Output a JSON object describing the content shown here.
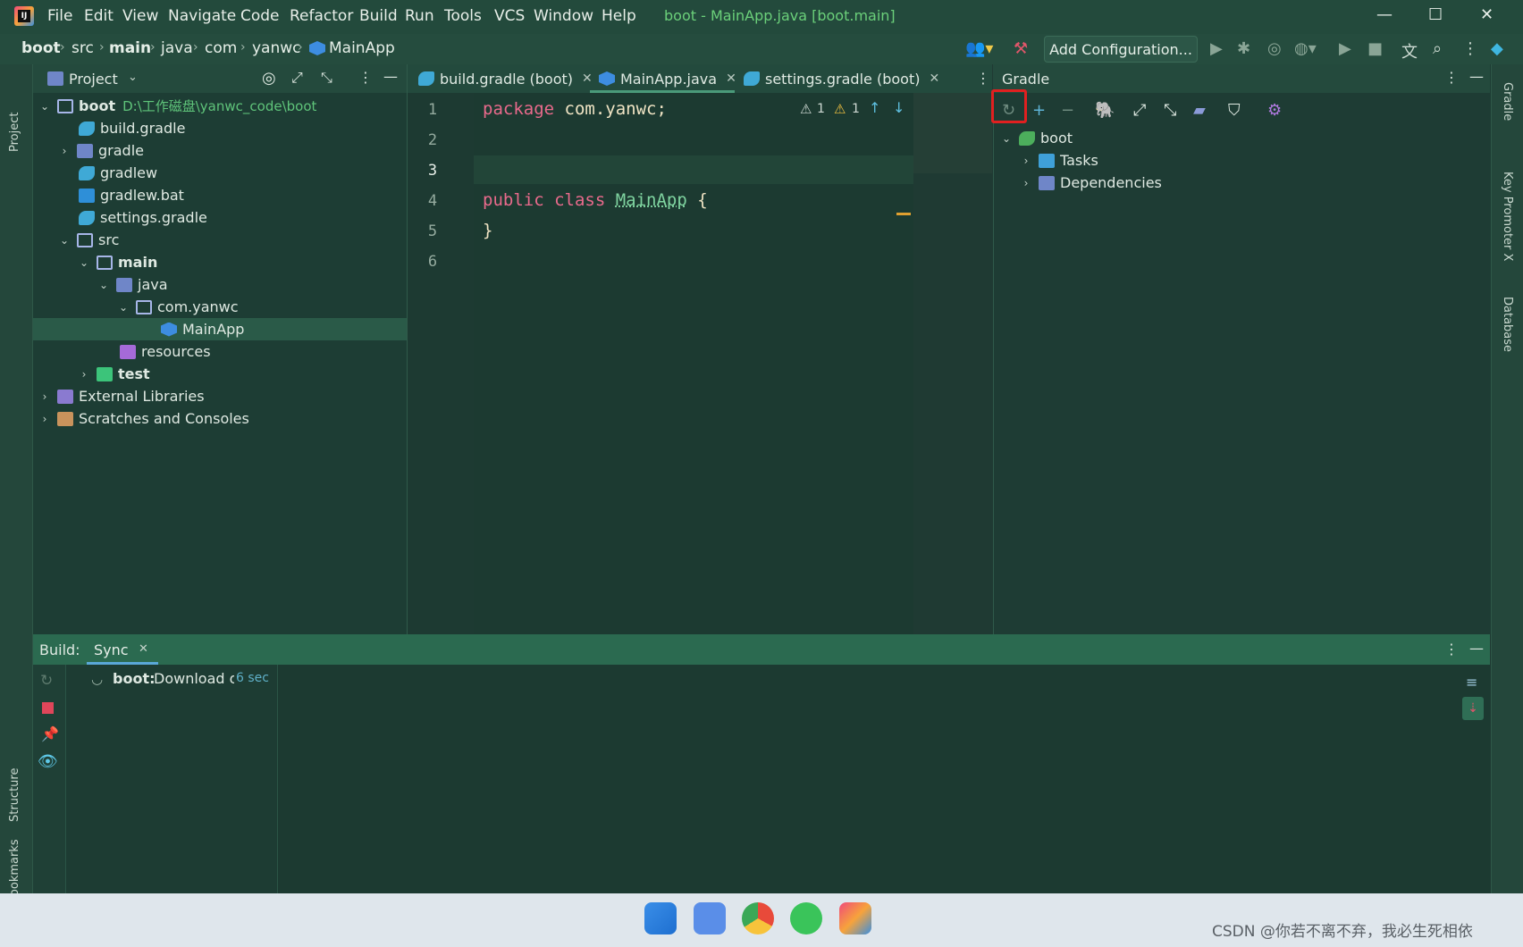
{
  "titlebar": {
    "menu": [
      "File",
      "Edit",
      "View",
      "Navigate",
      "Code",
      "Refactor",
      "Build",
      "Run",
      "Tools",
      "VCS",
      "Window",
      "Help"
    ],
    "window_title": "boot - MainApp.java [boot.main]"
  },
  "navbar": {
    "breadcrumbs": [
      "boot",
      "src",
      "main",
      "java",
      "com",
      "yanwc",
      "MainApp"
    ],
    "add_configuration": "Add Configuration..."
  },
  "left_stripe": {
    "project": "Project",
    "structure": "Structure",
    "bookmarks": "Bookmarks"
  },
  "right_stripe": {
    "gradle": "Gradle",
    "key_promoter": "Key Promoter X",
    "database": "Database"
  },
  "project_panel": {
    "title": "Project",
    "root_name": "boot",
    "root_path": "D:\\工作磁盘\\yanwc_code\\boot",
    "items": [
      {
        "label": "build.gradle"
      },
      {
        "label": "gradle"
      },
      {
        "label": "gradlew"
      },
      {
        "label": "gradlew.bat"
      },
      {
        "label": "settings.gradle"
      },
      {
        "label": "src"
      },
      {
        "label": "main"
      },
      {
        "label": "java"
      },
      {
        "label": "com.yanwc"
      },
      {
        "label": "MainApp"
      },
      {
        "label": "resources"
      },
      {
        "label": "test"
      },
      {
        "label": "External Libraries"
      },
      {
        "label": "Scratches and Consoles"
      }
    ]
  },
  "editor": {
    "tabs": [
      "build.gradle (boot)",
      "MainApp.java",
      "settings.gradle (boot)"
    ],
    "line_numbers": [
      "1",
      "2",
      "3",
      "4",
      "5",
      "6"
    ],
    "code": {
      "l1_kw": "package",
      "l1_rest": "com.yanwc;",
      "l4_kw": "public class",
      "l4_cls": "MainApp",
      "l4_brace": "{",
      "l5": "}"
    },
    "warnings": {
      "weak": "1",
      "strong": "1"
    }
  },
  "gradle_panel": {
    "title": "Gradle",
    "tree": {
      "root": "boot",
      "children": [
        "Tasks",
        "Dependencies"
      ]
    }
  },
  "build_panel": {
    "label": "Build:",
    "tab": "Sync",
    "task_name": "boot:",
    "task_text": "Download or",
    "task_time": "6 sec"
  },
  "watermark": "CSDN @你若不离不弃，我必生死相依",
  "colors": {
    "accent": "#2b6a50",
    "highlight": "#e02020",
    "keyword": "#e96a8c"
  }
}
